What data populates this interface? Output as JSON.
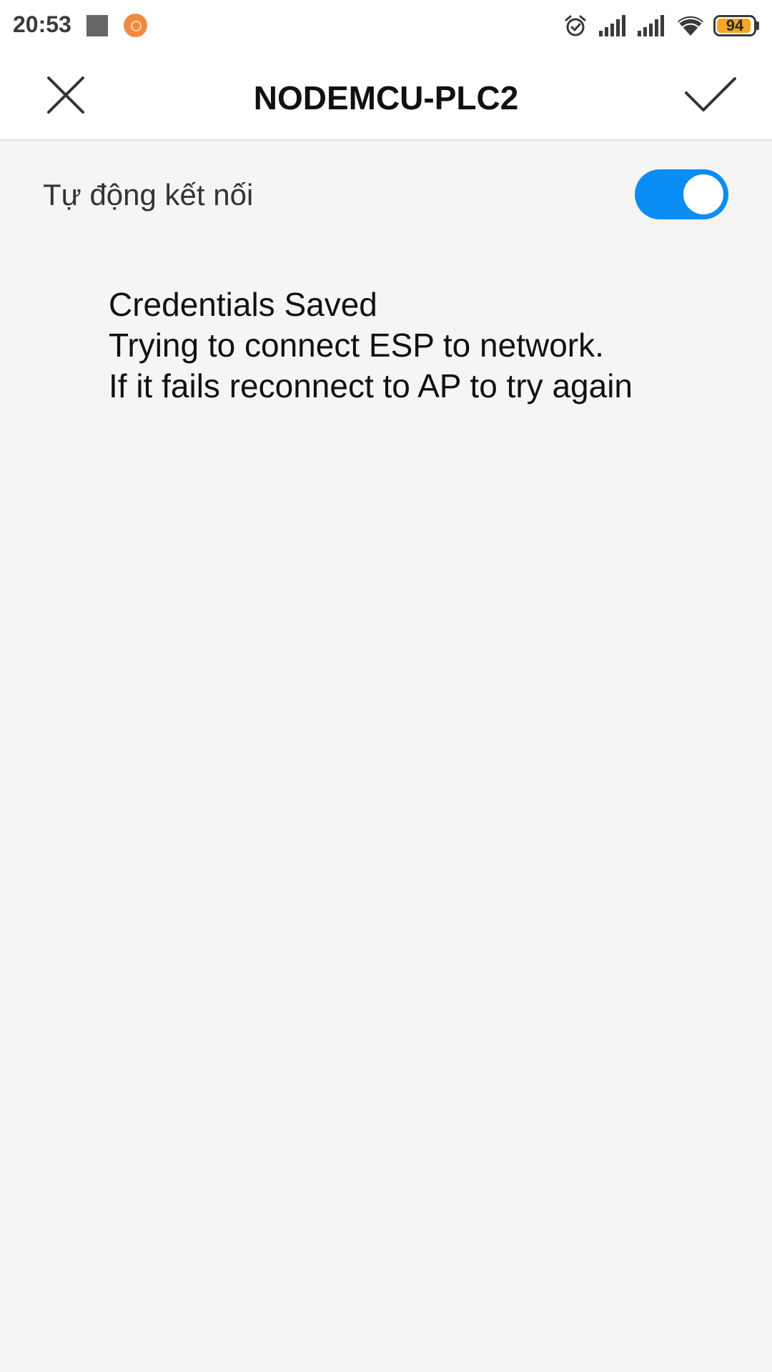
{
  "status_bar": {
    "time": "20:53",
    "battery_level": "94",
    "battery_fraction": 0.94,
    "icons": [
      "notification-square-icon",
      "app-notification-icon",
      "alarm-icon",
      "signal-icon",
      "signal-icon",
      "wifi-icon",
      "battery-icon"
    ],
    "battery_color": "#f5a623"
  },
  "header": {
    "title": "NODEMCU-PLC2",
    "left_icon": "close-icon",
    "right_icon": "check-icon"
  },
  "settings": {
    "auto_connect_label": "Tự động kết nối",
    "auto_connect_enabled": true,
    "toggle_color": "#0a8cf5"
  },
  "message": {
    "lines": [
      "Credentials Saved",
      "Trying to connect ESP to network.",
      "If it fails reconnect to AP to try again"
    ]
  }
}
